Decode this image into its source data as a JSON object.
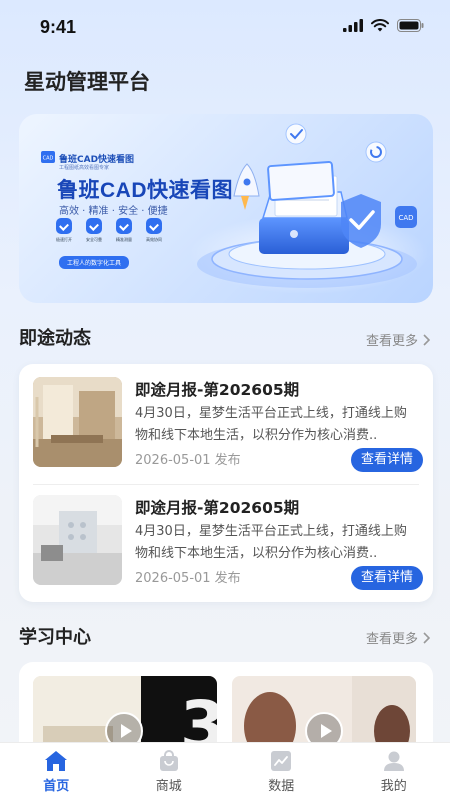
{
  "status_bar": {
    "time": "9:41"
  },
  "app": {
    "title": "星动管理平台"
  },
  "banner": {
    "small_title": "鲁班CAD快速看图",
    "tiny_text": "工程图纸高效看图专家",
    "main_title": "鲁班CAD快速看图",
    "subtitle": "高效 · 精准 · 安全 · 便捷",
    "features": [
      "极速打开",
      "安全可靠",
      "精准测量",
      "高效协同"
    ],
    "pill": "工程人的数字化工具",
    "cad_badge": "CAD"
  },
  "news": {
    "section_title": "即途动态",
    "more_label": "查看更多",
    "items": [
      {
        "title": "即途月报-第202605期",
        "desc": "4月30日，星梦生活平台正式上线，打通线上购物和线下本地生活，以积分作为核心消费..",
        "date": "2026-05-01 发布",
        "button": "查看详情"
      },
      {
        "title": "即途月报-第202605期",
        "desc": "4月30日，星梦生活平台正式上线，打通线上购物和线下本地生活，以积分作为核心消费..",
        "date": "2026-05-01 发布",
        "button": "查看详情"
      }
    ]
  },
  "learning": {
    "section_title": "学习中心",
    "more_label": "查看更多",
    "video_digit": "3"
  },
  "tabbar": {
    "items": [
      {
        "label": "首页",
        "icon": "home-icon",
        "active": true
      },
      {
        "label": "商城",
        "icon": "shop-bag-icon",
        "active": false
      },
      {
        "label": "数据",
        "icon": "chart-icon",
        "active": false
      },
      {
        "label": "我的",
        "icon": "user-icon",
        "active": false
      }
    ]
  },
  "colors": {
    "accent": "#2765e0",
    "background": "#eef2f8",
    "card": "#ffffff"
  }
}
